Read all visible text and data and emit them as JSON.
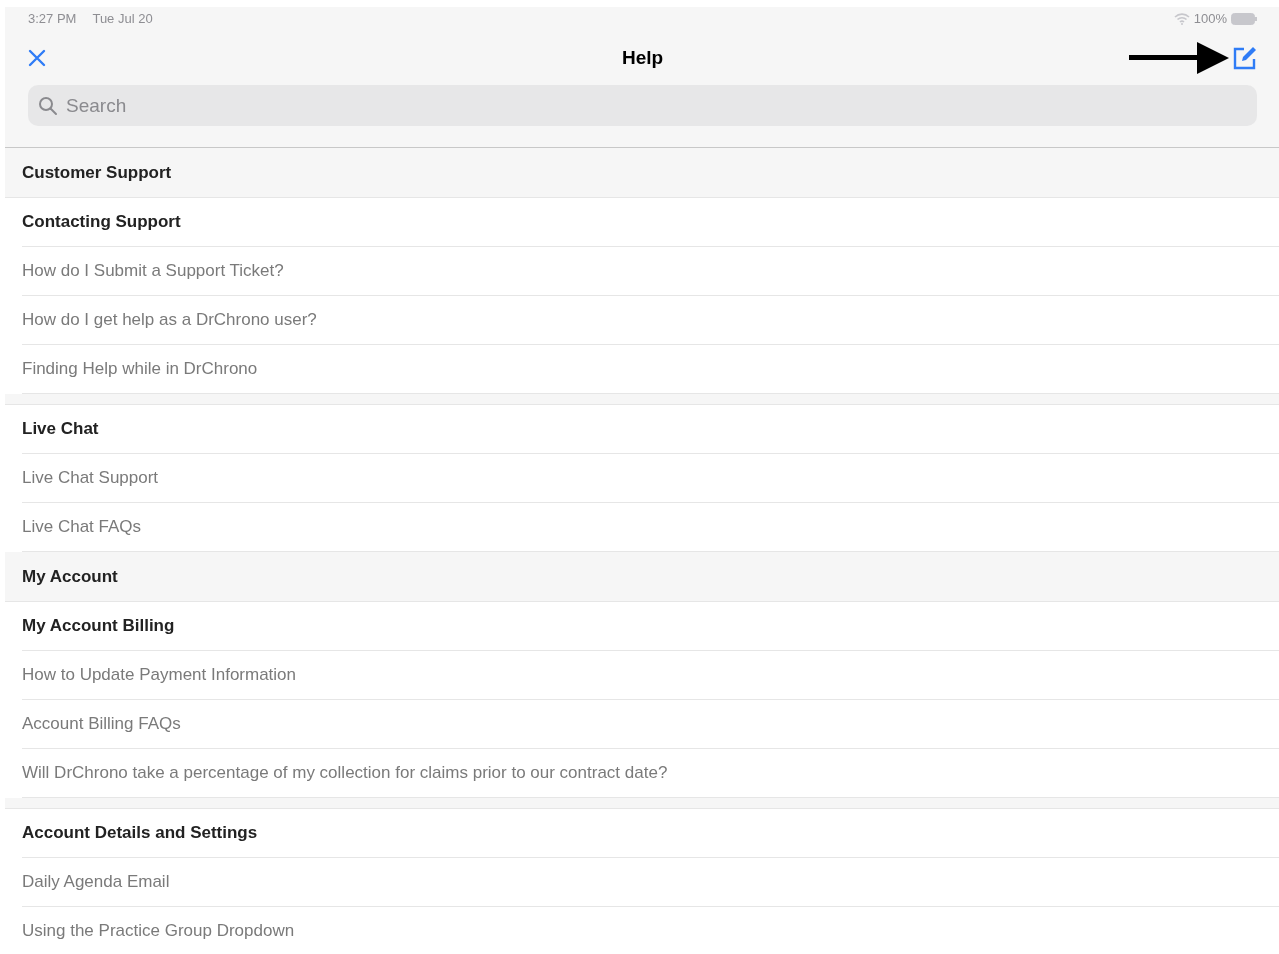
{
  "status_bar": {
    "time": "3:27 PM",
    "date": "Tue Jul 20",
    "battery": "100%"
  },
  "header": {
    "title": "Help"
  },
  "search": {
    "placeholder": "Search"
  },
  "sections": [
    {
      "title": "Customer Support",
      "groups": [
        {
          "title": "Contacting Support",
          "items": [
            "How do I Submit a Support Ticket?",
            "How do I get help as a DrChrono user?",
            "Finding Help while in DrChrono"
          ]
        },
        {
          "title": "Live Chat",
          "items": [
            "Live Chat Support",
            "Live Chat FAQs"
          ]
        }
      ]
    },
    {
      "title": "My Account",
      "groups": [
        {
          "title": "My Account Billing",
          "items": [
            "How to Update Payment Information",
            "Account Billing FAQs",
            "Will DrChrono take a percentage of my collection for claims prior to our contract date?"
          ]
        },
        {
          "title": "Account Details and Settings",
          "items": [
            "Daily Agenda Email",
            "Using the Practice Group Dropdown"
          ]
        }
      ]
    }
  ]
}
